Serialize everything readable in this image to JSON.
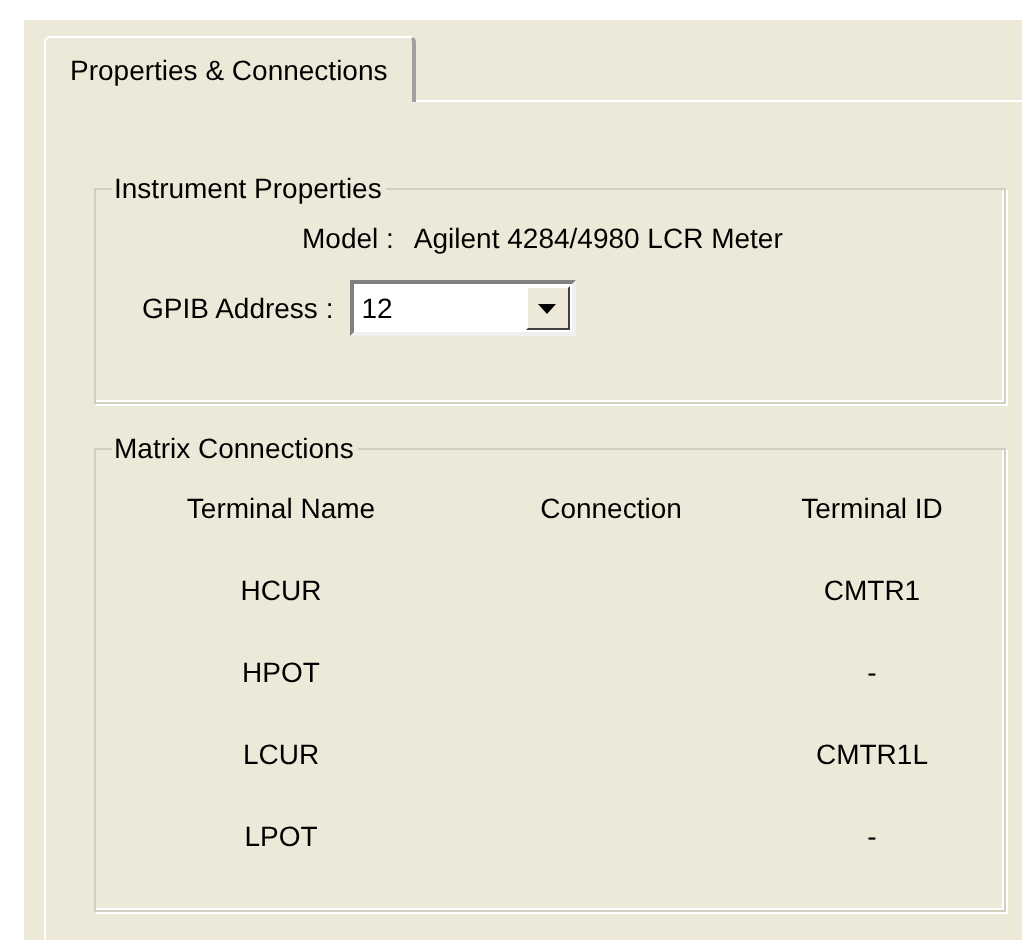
{
  "tabs": [
    {
      "label": "Properties & Connections",
      "selected": true
    }
  ],
  "instrument_properties": {
    "title": "Instrument Properties",
    "model_label": "Model :",
    "model_value": "Agilent 4284/4980 LCR Meter",
    "gpib_label": "GPIB Address :",
    "gpib_value": "12"
  },
  "matrix_connections": {
    "title": "Matrix Connections",
    "columns": [
      "Terminal Name",
      "Connection",
      "Terminal ID"
    ],
    "rows": [
      [
        "HCUR",
        "",
        "CMTR1"
      ],
      [
        "HPOT",
        "",
        "-"
      ],
      [
        "LCUR",
        "",
        "CMTR1L"
      ],
      [
        "LPOT",
        "",
        "-"
      ]
    ]
  }
}
